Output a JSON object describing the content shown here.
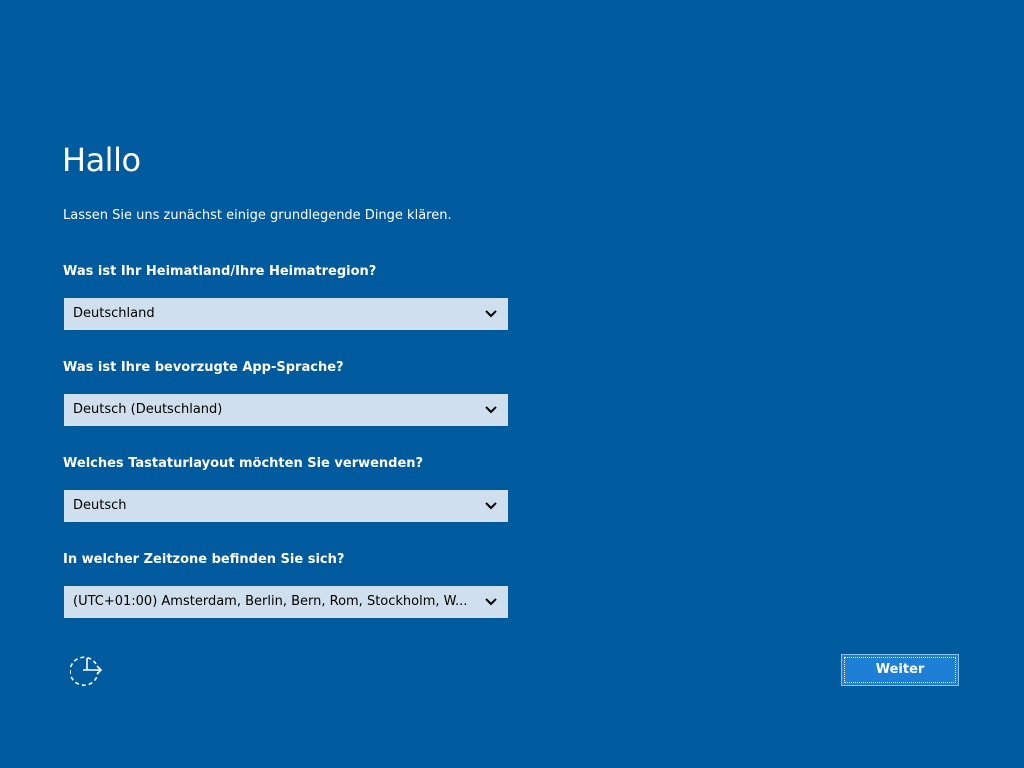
{
  "header": {
    "title": "Hallo",
    "subtitle": "Lassen Sie uns zunächst einige grundlegende Dinge klären."
  },
  "form": {
    "region": {
      "question": "Was ist Ihr Heimatland/Ihre Heimatregion?",
      "value": "Deutschland"
    },
    "app_language": {
      "question": "Was ist Ihre bevorzugte App-Sprache?",
      "value": "Deutsch (Deutschland)"
    },
    "keyboard": {
      "question": "Welches Tastaturlayout möchten Sie verwenden?",
      "value": "Deutsch"
    },
    "timezone": {
      "question": "In welcher Zeitzone befinden Sie sich?",
      "value": "(UTC+01:00) Amsterdam, Berlin, Bern, Rom, Stockholm, W..."
    }
  },
  "footer": {
    "ease_of_access_icon": "ease-of-access-icon",
    "next_label": "Weiter"
  },
  "colors": {
    "background": "#005a9e",
    "select_background": "#cfdfed",
    "accent_button": "#1e7fd6"
  }
}
